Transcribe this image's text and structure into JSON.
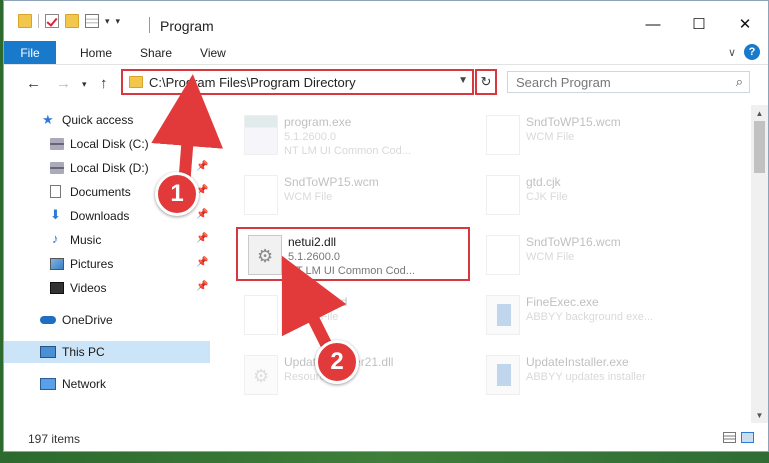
{
  "window": {
    "title": "Program",
    "controls": {
      "minimize": "—",
      "maximize": "☐",
      "close": "✕"
    }
  },
  "ribbon": {
    "tabs": [
      {
        "label": "File"
      },
      {
        "label": "Home"
      },
      {
        "label": "Share"
      },
      {
        "label": "View"
      }
    ],
    "help": "?"
  },
  "address": {
    "path": "C:\\Program Files\\Program Directory",
    "search_placeholder": "Search Program"
  },
  "nav": {
    "items": [
      {
        "label": "Quick access",
        "icon": "star-icon",
        "pinned": false
      },
      {
        "label": "Local Disk (C:)",
        "icon": "drive-icon",
        "pinned": true
      },
      {
        "label": "Local Disk (D:)",
        "icon": "drive-icon",
        "pinned": true
      },
      {
        "label": "Documents",
        "icon": "documents-icon",
        "pinned": true
      },
      {
        "label": "Downloads",
        "icon": "download-icon",
        "pinned": true
      },
      {
        "label": "Music",
        "icon": "music-icon",
        "pinned": true
      },
      {
        "label": "Pictures",
        "icon": "pictures-icon",
        "pinned": true
      },
      {
        "label": "Videos",
        "icon": "videos-icon",
        "pinned": true
      },
      {
        "label": "OneDrive",
        "icon": "cloud-icon",
        "pinned": false
      },
      {
        "label": "This PC",
        "icon": "computer-icon",
        "pinned": false,
        "selected": true
      },
      {
        "label": "Network",
        "icon": "network-icon",
        "pinned": false
      }
    ]
  },
  "files": [
    {
      "name": "program.exe",
      "line1": "5.1.2600.0",
      "line2": "NT LM UI Common Cod...",
      "icon": "exe",
      "faded": true
    },
    {
      "name": "SndToWP15.wcm",
      "line1": "WCM File",
      "line2": "",
      "icon": "blank",
      "faded": true
    },
    {
      "name": "SndToWP15.wcm",
      "line1": "WCM File",
      "line2": "",
      "icon": "blank",
      "faded": true
    },
    {
      "name": "gtd.cjk",
      "line1": "CJK File",
      "line2": "",
      "icon": "blank",
      "faded": true
    },
    {
      "name": "netui2.dll",
      "line1": "5.1.2600.0",
      "line2": "NT LM UI Common Cod...",
      "icon": "gear",
      "faded": false,
      "highlight": true
    },
    {
      "name": "SndToWP16.wcm",
      "line1": "WCM File",
      "line2": "",
      "icon": "blank",
      "faded": true
    },
    {
      "name": "AbExec.xcd",
      "line1": "WXCD File",
      "line2": "",
      "icon": "blank",
      "faded": true
    },
    {
      "name": "FineExec.exe",
      "line1": "ABBYY background exe...",
      "line2": "",
      "icon": "app",
      "faded": true
    },
    {
      "name": "UpdateInstaller21.dll",
      "line1": "Resources",
      "line2": "",
      "icon": "gear",
      "faded": true
    },
    {
      "name": "UpdateInstaller.exe",
      "line1": "ABBYY updates installer",
      "line2": "",
      "icon": "app",
      "faded": true
    }
  ],
  "status": {
    "item_count": "197 items"
  },
  "callouts": [
    {
      "number": "1"
    },
    {
      "number": "2"
    }
  ],
  "colors": {
    "accent": "#1979ca",
    "callout": "#e23a3a",
    "highlight_border": "#d9373f",
    "selection": "#cce4f7"
  }
}
